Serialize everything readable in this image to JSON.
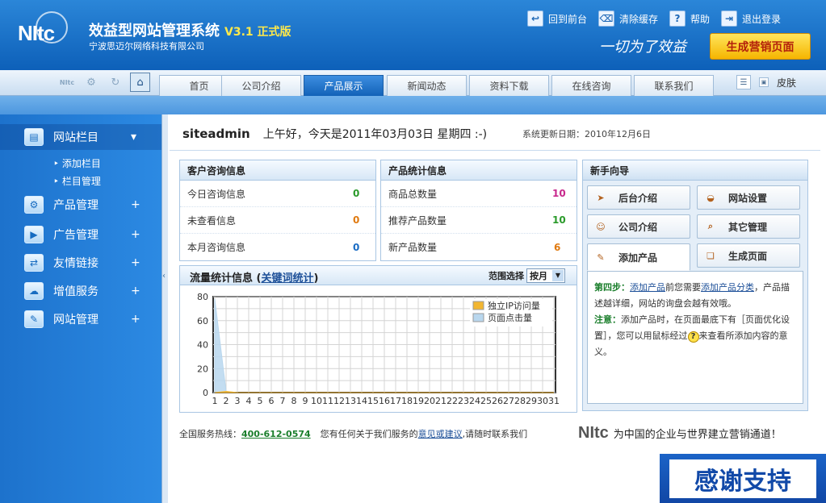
{
  "header": {
    "logo": "NItc",
    "title": "效益型网站管理系统",
    "version": "V3.1 正式版",
    "company": "宁波思迈尔网络科技有限公司",
    "links": [
      {
        "label": "回到前台",
        "icon": "return-icon",
        "glyph": "↩"
      },
      {
        "label": "清除缓存",
        "icon": "trash-icon",
        "glyph": "⌫"
      },
      {
        "label": "帮助",
        "icon": "help-icon",
        "glyph": "?"
      },
      {
        "label": "退出登录",
        "icon": "logout-icon",
        "glyph": "⇥"
      }
    ],
    "slogan": "一切为了效益",
    "generate_button": "生成营销页面"
  },
  "nav": {
    "tabs": [
      "首页",
      "公司介绍",
      "产品展示",
      "新闻动态",
      "资料下载",
      "在线咨询",
      "联系我们"
    ],
    "active_tab": 2,
    "skin_label": "皮肤",
    "home_glyph": "⌂"
  },
  "sidebar": {
    "items": [
      {
        "label": "网站栏目",
        "glyph": "▤",
        "icon": "column-icon",
        "toggle": "▾"
      },
      {
        "label": "产品管理",
        "glyph": "⚙",
        "icon": "product-gear-icon",
        "toggle": "+"
      },
      {
        "label": "广告管理",
        "glyph": "▶",
        "icon": "ad-screen-icon",
        "toggle": "+"
      },
      {
        "label": "友情链接",
        "glyph": "⇄",
        "icon": "link-icon",
        "toggle": "+"
      },
      {
        "label": "增值服务",
        "glyph": "☁",
        "icon": "service-icon",
        "toggle": "+"
      },
      {
        "label": "网站管理",
        "glyph": "✎",
        "icon": "site-manage-icon",
        "toggle": "+"
      }
    ],
    "subitems": [
      "添加栏目",
      "栏目管理"
    ]
  },
  "welcome": {
    "user": "siteadmin",
    "greeting": "上午好，今天是2011年03月03日 星期四 :-)",
    "update": "系统更新日期：2010年12月6日"
  },
  "consult": {
    "title": "客户咨询信息",
    "rows": [
      {
        "label": "今日咨询信息",
        "value": "0",
        "color": "#2a9a2a"
      },
      {
        "label": "未查看信息",
        "value": "0",
        "color": "#e07a10"
      },
      {
        "label": "本月咨询信息",
        "value": "0",
        "color": "#1a6cc4"
      }
    ]
  },
  "product_stats": {
    "title": "产品统计信息",
    "rows": [
      {
        "label": "商品总数量",
        "value": "10",
        "color": "#c8288c"
      },
      {
        "label": "推荐产品数量",
        "value": "10",
        "color": "#2a9a2a"
      },
      {
        "label": "新产品数量",
        "value": "6",
        "color": "#e07a10"
      }
    ]
  },
  "traffic": {
    "title": "流量统计信息",
    "link": "关键词统计",
    "range_label": "范围选择",
    "range_value": "按月"
  },
  "chart_data": {
    "type": "area",
    "x": [
      1,
      2,
      3,
      4,
      5,
      6,
      7,
      8,
      9,
      10,
      11,
      12,
      13,
      14,
      15,
      16,
      17,
      18,
      19,
      20,
      21,
      22,
      23,
      24,
      25,
      26,
      27,
      28,
      29,
      30,
      31
    ],
    "series": [
      {
        "name": "独立IP访问量",
        "color": "#f2b631",
        "values": [
          0,
          1,
          0,
          0,
          0,
          0,
          0,
          0,
          0,
          0,
          0,
          0,
          0,
          0,
          0,
          0,
          0,
          0,
          0,
          0,
          0,
          0,
          0,
          0,
          0,
          0,
          0,
          0,
          0,
          0,
          0
        ]
      },
      {
        "name": "页面点击量",
        "color": "#b9d7ee",
        "values": [
          78,
          1,
          0,
          0,
          0,
          0,
          0,
          0,
          0,
          0,
          0,
          0,
          0,
          0,
          0,
          0,
          0,
          0,
          0,
          0,
          0,
          0,
          0,
          0,
          0,
          0,
          0,
          0,
          0,
          0,
          0
        ]
      }
    ],
    "yticks": [
      "0",
      "20",
      "40",
      "60",
      "80"
    ],
    "ylim": [
      0,
      80
    ],
    "grid": true,
    "legend": "top-right"
  },
  "guide": {
    "title": "新手向导",
    "buttons": [
      {
        "label": "后台介绍",
        "glyph": "➤",
        "icon": "pointer-icon"
      },
      {
        "label": "网站设置",
        "glyph": "◒",
        "icon": "settings-icon"
      },
      {
        "label": "公司介绍",
        "glyph": "☺",
        "icon": "company-icon"
      },
      {
        "label": "其它管理",
        "glyph": "⌕",
        "icon": "magnify-icon"
      },
      {
        "label": "添加产品",
        "glyph": "✎",
        "icon": "add-product-icon"
      },
      {
        "label": "生成页面",
        "glyph": "❏",
        "icon": "generate-page-icon"
      }
    ],
    "step_label": "第四步：",
    "step_link1": "添加产品",
    "step_mid": "前您需要",
    "step_link2": "添加产品分类",
    "step_rest": "，产品描述越详细，网站的询盘会越有效哦。",
    "note_label": "注意：",
    "note_text1": "添加产品时，在页面最底下有［页面优化设置］，您可以用鼠标经过",
    "note_text2": "来查看所添加内容的意义。"
  },
  "footer": {
    "hotline_label": "全国服务热线：",
    "hotline": "400-612-0574",
    "text1": "您有任何关于我们服务的",
    "link": "意见或建议",
    "text2": ",请随时联系我们",
    "logo": "NItc",
    "tagline": "为中国的企业与世界建立营销通道！"
  },
  "thanks": "感谢支持"
}
